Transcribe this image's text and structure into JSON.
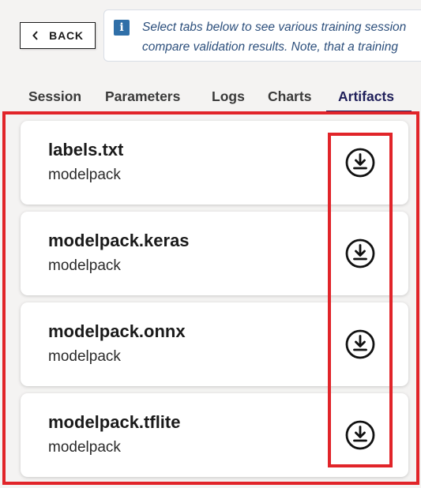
{
  "back_button": {
    "label": "BACK",
    "icon": "chevron-left-icon"
  },
  "info_banner": {
    "icon": "info-icon",
    "icon_glyph": "i",
    "lines": [
      "Select tabs below to see various training session",
      "compare validation results. Note, that a training"
    ]
  },
  "tabs": {
    "items": [
      {
        "label": "Session"
      },
      {
        "label": "Parameters"
      },
      {
        "label": "Logs"
      },
      {
        "label": "Charts"
      },
      {
        "label": "Artifacts",
        "active": true
      }
    ]
  },
  "artifacts": [
    {
      "name": "labels.txt",
      "type": "modelpack",
      "action_icon": "download-icon"
    },
    {
      "name": "modelpack.keras",
      "type": "modelpack",
      "action_icon": "download-icon"
    },
    {
      "name": "modelpack.onnx",
      "type": "modelpack",
      "action_icon": "download-icon"
    },
    {
      "name": "modelpack.tflite",
      "type": "modelpack",
      "action_icon": "download-icon"
    }
  ],
  "colors": {
    "page_background": "#f4f3f2",
    "active_tab": "#1f1f5a",
    "info_text": "#2c4f7c",
    "info_icon_bg": "#2f6fa8",
    "highlight": "#e12429"
  }
}
